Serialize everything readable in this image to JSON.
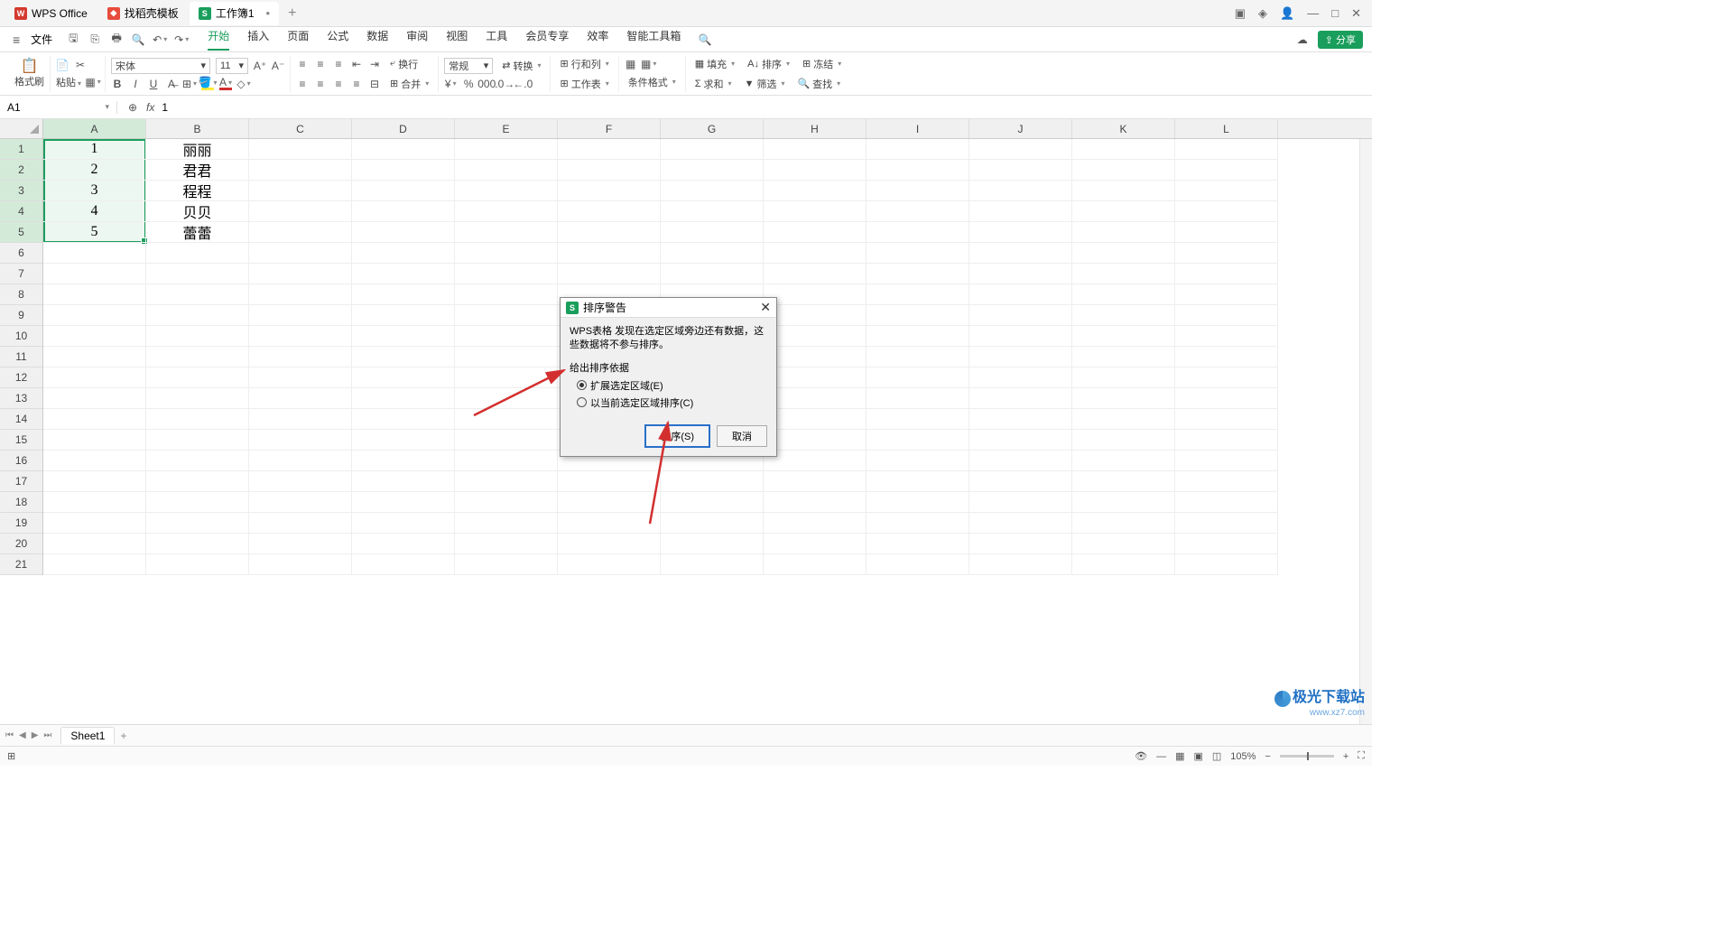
{
  "titlebar": {
    "tab0": "WPS Office",
    "tab1": "找稻壳模板",
    "tab2": "工作簿1"
  },
  "menubar": {
    "file": "文件",
    "items": [
      "开始",
      "插入",
      "页面",
      "公式",
      "数据",
      "审阅",
      "视图",
      "工具",
      "会员专享",
      "效率",
      "智能工具箱"
    ],
    "share": "分享"
  },
  "ribbon": {
    "formatpaint": "格式刷",
    "paste": "粘贴",
    "font": "宋体",
    "fontsize": "11",
    "numfmt": "常规",
    "convert": "转换",
    "rowcol": "行和列",
    "worksheet": "工作表",
    "condfmt": "条件格式",
    "fill": "填充",
    "sort": "排序",
    "sum": "求和",
    "filter": "筛选",
    "freeze": "冻结",
    "find": "查找",
    "wrap": "换行",
    "merge": "合并"
  },
  "namebox": "A1",
  "formula_value": "1",
  "columns": [
    "A",
    "B",
    "C",
    "D",
    "E",
    "F",
    "G",
    "H",
    "I",
    "J",
    "K",
    "L"
  ],
  "rows": 21,
  "data": {
    "A": [
      "1",
      "2",
      "3",
      "4",
      "5"
    ],
    "B": [
      "丽丽",
      "君君",
      "程程",
      "贝贝",
      "蕾蕾"
    ]
  },
  "sheet": "Sheet1",
  "dialog": {
    "title": "排序警告",
    "message": "WPS表格 发现在选定区域旁边还有数据，这些数据将不参与排序。",
    "group_label": "给出排序依据",
    "opt1": "扩展选定区域(E)",
    "opt2": "以当前选定区域排序(C)",
    "ok": "排序(S)",
    "cancel": "取消"
  },
  "status": {
    "zoom": "105%"
  },
  "watermark": {
    "text": "极光下载站",
    "url": "www.xz7.com"
  }
}
